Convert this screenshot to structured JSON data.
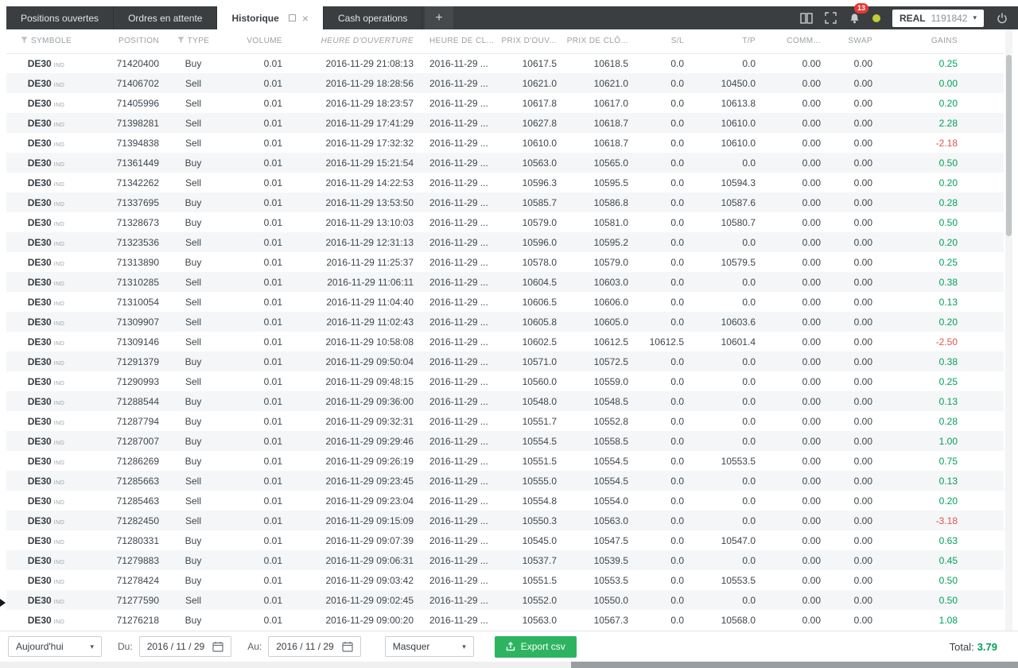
{
  "icons": {
    "close": "×",
    "caret_down": "▾",
    "add_tab": "+"
  },
  "colors": {
    "topbar_dark": "#3a3e41",
    "profit_green": "#00a05a",
    "loss_red": "#e0544a",
    "export_green": "#2eb461",
    "badge_red": "#e53935",
    "status_dot_yellow": "#c3cf2f"
  },
  "topbar": {
    "tabs": [
      {
        "label": "Positions ouvertes",
        "active": false
      },
      {
        "label": "Ordres en attente",
        "active": false
      },
      {
        "label": "Historique",
        "active": true
      },
      {
        "label": "Cash operations",
        "active": false
      }
    ],
    "notification_badge": "13",
    "account": {
      "type": "REAL",
      "number": "1191842"
    }
  },
  "table": {
    "columns": [
      {
        "key": "symbol",
        "label": "SYMBOLE",
        "align": "center",
        "filter": true
      },
      {
        "key": "position",
        "label": "POSITION",
        "align": "right"
      },
      {
        "key": "type",
        "label": "TYPE",
        "align": "center",
        "filter": true
      },
      {
        "key": "volume",
        "label": "VOLUME",
        "align": "right"
      },
      {
        "key": "open_time",
        "label": "HEURE D'OUVERTURE",
        "align": "right",
        "italic": true
      },
      {
        "key": "close_time",
        "label": "HEURE DE CL...",
        "align": "left"
      },
      {
        "key": "open_price",
        "label": "PRIX D'OUV...",
        "align": "right"
      },
      {
        "key": "close_price",
        "label": "PRIX DE CLÔ...",
        "align": "right"
      },
      {
        "key": "sl",
        "label": "S/L",
        "align": "right"
      },
      {
        "key": "tp",
        "label": "T/P",
        "align": "right"
      },
      {
        "key": "comm",
        "label": "COMM...",
        "align": "right"
      },
      {
        "key": "swap",
        "label": "SWAP",
        "align": "right"
      },
      {
        "key": "gains",
        "label": "GAINS",
        "align": "right"
      }
    ],
    "rows": [
      {
        "symbol": "DE30",
        "symbol_suffix": "IND",
        "position": "71420400",
        "type": "Buy",
        "volume": "0.01",
        "open_time": "2016-11-29 21:08:13",
        "close_time": "2016-11-29 ...",
        "open_price": "10617.5",
        "close_price": "10618.5",
        "sl": "0.0",
        "tp": "0.0",
        "comm": "0.00",
        "swap": "0.00",
        "gains": "0.25"
      },
      {
        "symbol": "DE30",
        "symbol_suffix": "IND",
        "position": "71406702",
        "type": "Sell",
        "volume": "0.01",
        "open_time": "2016-11-29 18:28:56",
        "close_time": "2016-11-29 ...",
        "open_price": "10621.0",
        "close_price": "10621.0",
        "sl": "0.0",
        "tp": "10450.0",
        "comm": "0.00",
        "swap": "0.00",
        "gains": "0.00"
      },
      {
        "symbol": "DE30",
        "symbol_suffix": "IND",
        "position": "71405996",
        "type": "Sell",
        "volume": "0.01",
        "open_time": "2016-11-29 18:23:57",
        "close_time": "2016-11-29 ...",
        "open_price": "10617.8",
        "close_price": "10617.0",
        "sl": "0.0",
        "tp": "10613.8",
        "comm": "0.00",
        "swap": "0.00",
        "gains": "0.20"
      },
      {
        "symbol": "DE30",
        "symbol_suffix": "IND",
        "position": "71398281",
        "type": "Sell",
        "volume": "0.01",
        "open_time": "2016-11-29 17:41:29",
        "close_time": "2016-11-29 ...",
        "open_price": "10627.8",
        "close_price": "10618.7",
        "sl": "0.0",
        "tp": "10610.0",
        "comm": "0.00",
        "swap": "0.00",
        "gains": "2.28"
      },
      {
        "symbol": "DE30",
        "symbol_suffix": "IND",
        "position": "71394838",
        "type": "Sell",
        "volume": "0.01",
        "open_time": "2016-11-29 17:32:32",
        "close_time": "2016-11-29 ...",
        "open_price": "10610.0",
        "close_price": "10618.7",
        "sl": "0.0",
        "tp": "10610.0",
        "comm": "0.00",
        "swap": "0.00",
        "gains": "-2.18"
      },
      {
        "symbol": "DE30",
        "symbol_suffix": "IND",
        "position": "71361449",
        "type": "Buy",
        "volume": "0.01",
        "open_time": "2016-11-29 15:21:54",
        "close_time": "2016-11-29 ...",
        "open_price": "10563.0",
        "close_price": "10565.0",
        "sl": "0.0",
        "tp": "0.0",
        "comm": "0.00",
        "swap": "0.00",
        "gains": "0.50"
      },
      {
        "symbol": "DE30",
        "symbol_suffix": "IND",
        "position": "71342262",
        "type": "Sell",
        "volume": "0.01",
        "open_time": "2016-11-29 14:22:53",
        "close_time": "2016-11-29 ...",
        "open_price": "10596.3",
        "close_price": "10595.5",
        "sl": "0.0",
        "tp": "10594.3",
        "comm": "0.00",
        "swap": "0.00",
        "gains": "0.20"
      },
      {
        "symbol": "DE30",
        "symbol_suffix": "IND",
        "position": "71337695",
        "type": "Buy",
        "volume": "0.01",
        "open_time": "2016-11-29 13:53:50",
        "close_time": "2016-11-29 ...",
        "open_price": "10585.7",
        "close_price": "10586.8",
        "sl": "0.0",
        "tp": "10587.6",
        "comm": "0.00",
        "swap": "0.00",
        "gains": "0.28"
      },
      {
        "symbol": "DE30",
        "symbol_suffix": "IND",
        "position": "71328673",
        "type": "Buy",
        "volume": "0.01",
        "open_time": "2016-11-29 13:10:03",
        "close_time": "2016-11-29 ...",
        "open_price": "10579.0",
        "close_price": "10581.0",
        "sl": "0.0",
        "tp": "10580.7",
        "comm": "0.00",
        "swap": "0.00",
        "gains": "0.50"
      },
      {
        "symbol": "DE30",
        "symbol_suffix": "IND",
        "position": "71323536",
        "type": "Sell",
        "volume": "0.01",
        "open_time": "2016-11-29 12:31:13",
        "close_time": "2016-11-29 ...",
        "open_price": "10596.0",
        "close_price": "10595.2",
        "sl": "0.0",
        "tp": "0.0",
        "comm": "0.00",
        "swap": "0.00",
        "gains": "0.20"
      },
      {
        "symbol": "DE30",
        "symbol_suffix": "IND",
        "position": "71313890",
        "type": "Buy",
        "volume": "0.01",
        "open_time": "2016-11-29 11:25:37",
        "close_time": "2016-11-29 ...",
        "open_price": "10578.0",
        "close_price": "10579.0",
        "sl": "0.0",
        "tp": "10579.5",
        "comm": "0.00",
        "swap": "0.00",
        "gains": "0.25"
      },
      {
        "symbol": "DE30",
        "symbol_suffix": "IND",
        "position": "71310285",
        "type": "Sell",
        "volume": "0.01",
        "open_time": "2016-11-29 11:06:11",
        "close_time": "2016-11-29 ...",
        "open_price": "10604.5",
        "close_price": "10603.0",
        "sl": "0.0",
        "tp": "0.0",
        "comm": "0.00",
        "swap": "0.00",
        "gains": "0.38"
      },
      {
        "symbol": "DE30",
        "symbol_suffix": "IND",
        "position": "71310054",
        "type": "Sell",
        "volume": "0.01",
        "open_time": "2016-11-29 11:04:40",
        "close_time": "2016-11-29 ...",
        "open_price": "10606.5",
        "close_price": "10606.0",
        "sl": "0.0",
        "tp": "0.0",
        "comm": "0.00",
        "swap": "0.00",
        "gains": "0.13"
      },
      {
        "symbol": "DE30",
        "symbol_suffix": "IND",
        "position": "71309907",
        "type": "Sell",
        "volume": "0.01",
        "open_time": "2016-11-29 11:02:43",
        "close_time": "2016-11-29 ...",
        "open_price": "10605.8",
        "close_price": "10605.0",
        "sl": "0.0",
        "tp": "10603.6",
        "comm": "0.00",
        "swap": "0.00",
        "gains": "0.20"
      },
      {
        "symbol": "DE30",
        "symbol_suffix": "IND",
        "position": "71309146",
        "type": "Sell",
        "volume": "0.01",
        "open_time": "2016-11-29 10:58:08",
        "close_time": "2016-11-29 ...",
        "open_price": "10602.5",
        "close_price": "10612.5",
        "sl": "10612.5",
        "tp": "10601.4",
        "comm": "0.00",
        "swap": "0.00",
        "gains": "-2.50"
      },
      {
        "symbol": "DE30",
        "symbol_suffix": "IND",
        "position": "71291379",
        "type": "Buy",
        "volume": "0.01",
        "open_time": "2016-11-29 09:50:04",
        "close_time": "2016-11-29 ...",
        "open_price": "10571.0",
        "close_price": "10572.5",
        "sl": "0.0",
        "tp": "0.0",
        "comm": "0.00",
        "swap": "0.00",
        "gains": "0.38"
      },
      {
        "symbol": "DE30",
        "symbol_suffix": "IND",
        "position": "71290993",
        "type": "Sell",
        "volume": "0.01",
        "open_time": "2016-11-29 09:48:15",
        "close_time": "2016-11-29 ...",
        "open_price": "10560.0",
        "close_price": "10559.0",
        "sl": "0.0",
        "tp": "0.0",
        "comm": "0.00",
        "swap": "0.00",
        "gains": "0.25"
      },
      {
        "symbol": "DE30",
        "symbol_suffix": "IND",
        "position": "71288544",
        "type": "Buy",
        "volume": "0.01",
        "open_time": "2016-11-29 09:36:00",
        "close_time": "2016-11-29 ...",
        "open_price": "10548.0",
        "close_price": "10548.5",
        "sl": "0.0",
        "tp": "0.0",
        "comm": "0.00",
        "swap": "0.00",
        "gains": "0.13"
      },
      {
        "symbol": "DE30",
        "symbol_suffix": "IND",
        "position": "71287794",
        "type": "Buy",
        "volume": "0.01",
        "open_time": "2016-11-29 09:32:31",
        "close_time": "2016-11-29 ...",
        "open_price": "10551.7",
        "close_price": "10552.8",
        "sl": "0.0",
        "tp": "0.0",
        "comm": "0.00",
        "swap": "0.00",
        "gains": "0.28"
      },
      {
        "symbol": "DE30",
        "symbol_suffix": "IND",
        "position": "71287007",
        "type": "Buy",
        "volume": "0.01",
        "open_time": "2016-11-29 09:29:46",
        "close_time": "2016-11-29 ...",
        "open_price": "10554.5",
        "close_price": "10558.5",
        "sl": "0.0",
        "tp": "0.0",
        "comm": "0.00",
        "swap": "0.00",
        "gains": "1.00"
      },
      {
        "symbol": "DE30",
        "symbol_suffix": "IND",
        "position": "71286269",
        "type": "Buy",
        "volume": "0.01",
        "open_time": "2016-11-29 09:26:19",
        "close_time": "2016-11-29 ...",
        "open_price": "10551.5",
        "close_price": "10554.5",
        "sl": "0.0",
        "tp": "10553.5",
        "comm": "0.00",
        "swap": "0.00",
        "gains": "0.75"
      },
      {
        "symbol": "DE30",
        "symbol_suffix": "IND",
        "position": "71285663",
        "type": "Sell",
        "volume": "0.01",
        "open_time": "2016-11-29 09:23:45",
        "close_time": "2016-11-29 ...",
        "open_price": "10555.0",
        "close_price": "10554.5",
        "sl": "0.0",
        "tp": "0.0",
        "comm": "0.00",
        "swap": "0.00",
        "gains": "0.13"
      },
      {
        "symbol": "DE30",
        "symbol_suffix": "IND",
        "position": "71285463",
        "type": "Sell",
        "volume": "0.01",
        "open_time": "2016-11-29 09:23:04",
        "close_time": "2016-11-29 ...",
        "open_price": "10554.8",
        "close_price": "10554.0",
        "sl": "0.0",
        "tp": "0.0",
        "comm": "0.00",
        "swap": "0.00",
        "gains": "0.20"
      },
      {
        "symbol": "DE30",
        "symbol_suffix": "IND",
        "position": "71282450",
        "type": "Sell",
        "volume": "0.01",
        "open_time": "2016-11-29 09:15:09",
        "close_time": "2016-11-29 ...",
        "open_price": "10550.3",
        "close_price": "10563.0",
        "sl": "0.0",
        "tp": "0.0",
        "comm": "0.00",
        "swap": "0.00",
        "gains": "-3.18"
      },
      {
        "symbol": "DE30",
        "symbol_suffix": "IND",
        "position": "71280331",
        "type": "Buy",
        "volume": "0.01",
        "open_time": "2016-11-29 09:07:39",
        "close_time": "2016-11-29 ...",
        "open_price": "10545.0",
        "close_price": "10547.5",
        "sl": "0.0",
        "tp": "10547.0",
        "comm": "0.00",
        "swap": "0.00",
        "gains": "0.63"
      },
      {
        "symbol": "DE30",
        "symbol_suffix": "IND",
        "position": "71279883",
        "type": "Buy",
        "volume": "0.01",
        "open_time": "2016-11-29 09:06:31",
        "close_time": "2016-11-29 ...",
        "open_price": "10537.7",
        "close_price": "10539.5",
        "sl": "0.0",
        "tp": "0.0",
        "comm": "0.00",
        "swap": "0.00",
        "gains": "0.45"
      },
      {
        "symbol": "DE30",
        "symbol_suffix": "IND",
        "position": "71278424",
        "type": "Buy",
        "volume": "0.01",
        "open_time": "2016-11-29 09:03:42",
        "close_time": "2016-11-29 ...",
        "open_price": "10551.5",
        "close_price": "10553.5",
        "sl": "0.0",
        "tp": "10553.5",
        "comm": "0.00",
        "swap": "0.00",
        "gains": "0.50"
      },
      {
        "symbol": "DE30",
        "symbol_suffix": "IND",
        "position": "71277590",
        "type": "Sell",
        "volume": "0.01",
        "open_time": "2016-11-29 09:02:45",
        "close_time": "2016-11-29 ...",
        "open_price": "10552.0",
        "close_price": "10550.0",
        "sl": "0.0",
        "tp": "0.0",
        "comm": "0.00",
        "swap": "0.00",
        "gains": "0.50"
      },
      {
        "symbol": "DE30",
        "symbol_suffix": "IND",
        "position": "71276218",
        "type": "Buy",
        "volume": "0.01",
        "open_time": "2016-11-29 09:00:20",
        "close_time": "2016-11-29 ...",
        "open_price": "10563.0",
        "close_price": "10567.3",
        "sl": "0.0",
        "tp": "10568.0",
        "comm": "0.00",
        "swap": "0.00",
        "gains": "1.08"
      }
    ]
  },
  "footer": {
    "period_select": "Aujourd'hui",
    "from_label": "Du:",
    "from_value": "2016 / 11 / 29",
    "to_label": "Au:",
    "to_value": "2016 / 11 / 29",
    "filter_select": "Masquer",
    "export_button": "Export csv",
    "total_label": "Total:",
    "total_value": "3.79"
  }
}
